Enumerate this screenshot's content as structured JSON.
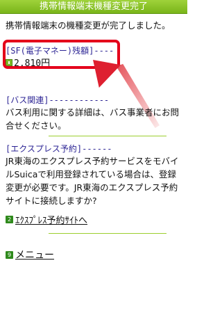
{
  "header": {
    "title": "携帯情報端末機種変更完了"
  },
  "intro": {
    "text": "携帯情報端末の機種変更が完了しました。"
  },
  "sf_section": {
    "title": "[SF(電子マネー)残額]----",
    "balance": "2,810円",
    "icon": "yen-icon"
  },
  "bus_section": {
    "title": "[バス関連]------------",
    "text": "バス利用に関する詳細は、バス事業者にお問合せください。"
  },
  "express_section": {
    "title": "[エクスプレス予約]------",
    "text": "JR東海のエクスプレス予約サービスをモバイルSuicaで利用登録されている場合は、登録変更が必要です。JR東海のエクスプレス予約サイトに接続しますか?"
  },
  "links": {
    "express_site": {
      "label": "ｴｸｽﾌﾟﾚｽ予約ｻｲﾄへ",
      "key": "2"
    },
    "menu": {
      "label": "メニュー",
      "key": "9"
    }
  },
  "colors": {
    "header_green": "#8cc52b",
    "title_blue": "#2c2494",
    "highlight_red": "#e4001b"
  }
}
